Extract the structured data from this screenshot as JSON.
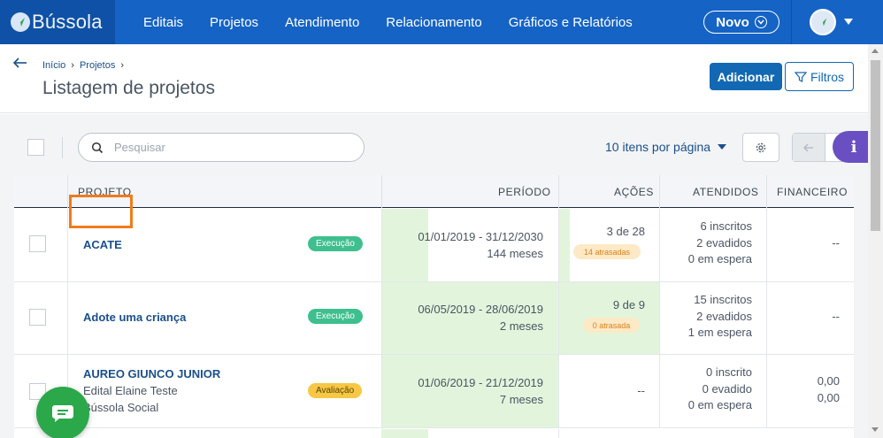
{
  "app": {
    "brand": "Bússola"
  },
  "nav": {
    "items": [
      {
        "label": "Editais"
      },
      {
        "label": "Projetos"
      },
      {
        "label": "Atendimento"
      },
      {
        "label": "Relacionamento"
      },
      {
        "label": "Gráficos e Relatórios"
      }
    ],
    "new_button": "Novo"
  },
  "header": {
    "breadcrumb": [
      {
        "label": "Início"
      },
      {
        "label": "Projetos"
      }
    ],
    "title": "Listagem de projetos",
    "add_button": "Adicionar",
    "filter_button": "Filtros"
  },
  "toolbar": {
    "search_placeholder": "Pesquisar",
    "per_page": "10 itens por página"
  },
  "table": {
    "columns": {
      "projeto": "PROJETO",
      "periodo": "PERÍODO",
      "acoes": "AÇÕES",
      "atendidos": "ATENDIDOS",
      "financeiro": "FINANCEIRO"
    },
    "rows": [
      {
        "name": "ACATE",
        "subtitle": [
          "",
          ""
        ],
        "status": "Execução",
        "period_range": "01/01/2019 - 31/12/2030",
        "period_months": "144 meses",
        "actions": "3 de 28",
        "late": "14 atrasadas",
        "attended": [
          "6 inscritos",
          "2 evadidos",
          "0 em espera"
        ],
        "financial": [
          "--"
        ]
      },
      {
        "name": "Adote uma criança",
        "subtitle": [
          "",
          ""
        ],
        "status": "Execução",
        "period_range": "06/05/2019 - 28/06/2019",
        "period_months": "2 meses",
        "actions": "9 de 9",
        "late": "0 atrasada",
        "attended": [
          "15 inscritos",
          "2 evadidos",
          "1 em espera"
        ],
        "financial": [
          "--"
        ]
      },
      {
        "name": "AUREO GIUNCO JUNIOR",
        "subtitle": [
          "Edital Elaine Teste",
          "Bússola Social"
        ],
        "status": "Avaliação",
        "period_range": "01/06/2019 - 21/12/2019",
        "period_months": "7 meses",
        "actions": "--",
        "late": "",
        "attended": [
          "0 inscrito",
          "0 evadido",
          "0 em espera"
        ],
        "financial": [
          "0,00",
          "0,00"
        ]
      }
    ]
  },
  "colors": {
    "nav_bg": "#1563c4",
    "brand_bg": "#0f51a6",
    "accent": "#1268b3",
    "status_exec": "#3fbf8f",
    "status_aval": "#f7c845",
    "period_fill": "#e2f5dc",
    "highlight": "#f07b1e",
    "info_fab": "#6a4fc2",
    "chat_fab": "#2aa84a"
  },
  "icons": {
    "brand": "compass-icon",
    "back": "arrow-left-icon",
    "search": "search-icon",
    "filter": "funnel-icon",
    "settings": "gear-icon",
    "info": "info-icon",
    "chat": "chat-icon"
  }
}
